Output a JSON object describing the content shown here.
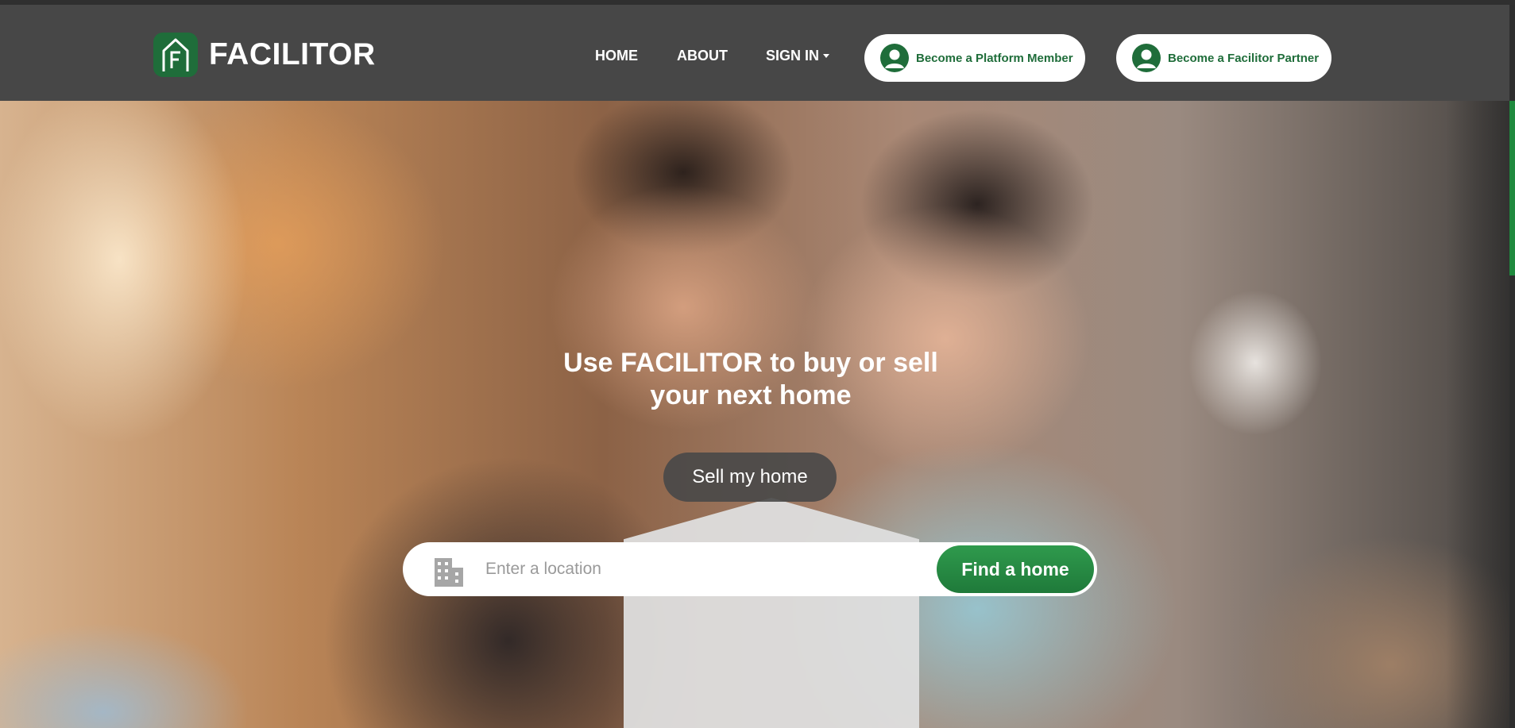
{
  "brand": {
    "name": "FACILITOR",
    "logo_icon": "house-f-icon",
    "color": "#1f6d3a"
  },
  "nav": {
    "home": "HOME",
    "about": "ABOUT",
    "sign_in": "SIGN IN",
    "member_button": "Become a Platform Member",
    "partner_button": "Become a Facilitor Partner",
    "button_icon": "user-circle-icon"
  },
  "hero": {
    "headline_line1": "Use FACILITOR to buy or sell",
    "headline_line2": "your next home",
    "sell_button": "Sell my home",
    "search": {
      "placeholder": "Enter a location",
      "value": "",
      "icon": "building-icon",
      "button": "Find a home"
    }
  },
  "colors": {
    "header_bg": "#474747",
    "accent_green": "#1f7a3a",
    "button_text_green": "#1f6d3a"
  }
}
